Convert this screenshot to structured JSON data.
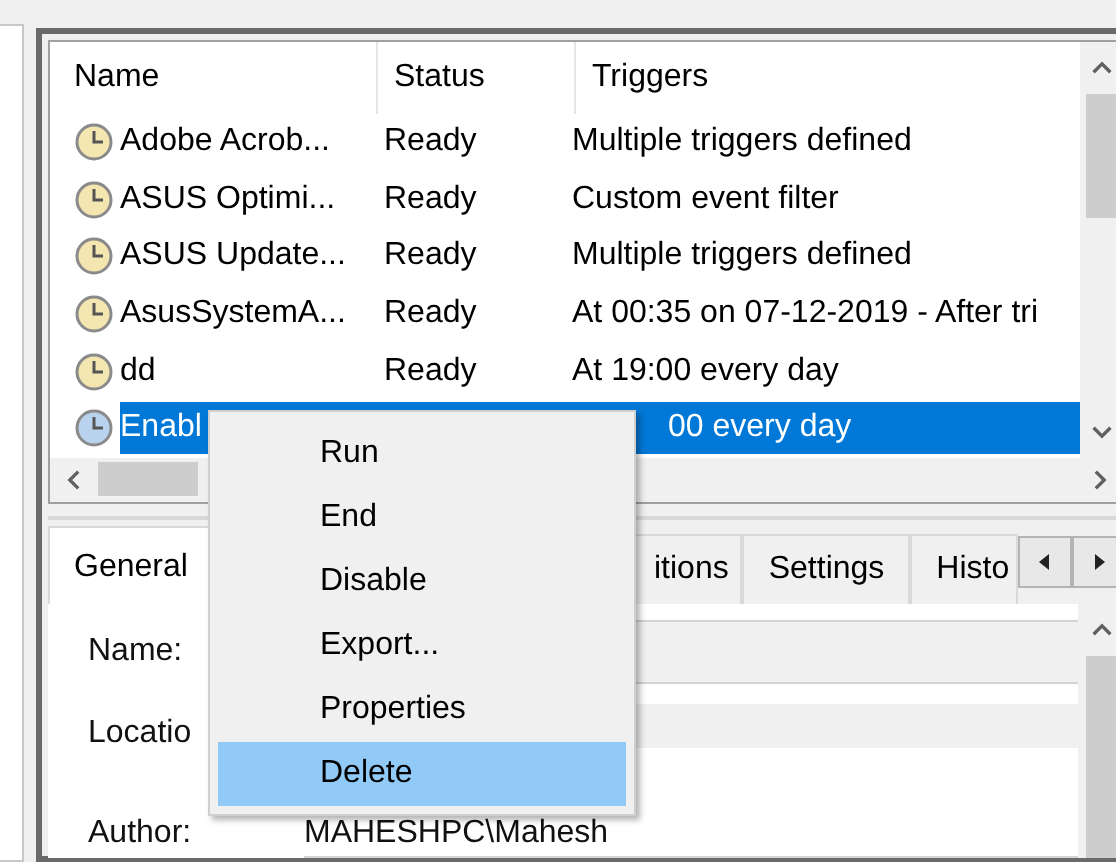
{
  "task_list": {
    "columns": [
      "Name",
      "Status",
      "Triggers"
    ],
    "rows": [
      {
        "name": "Adobe Acrob...",
        "status": "Ready",
        "triggers": "Multiple triggers defined",
        "selected": false
      },
      {
        "name": "ASUS Optimi...",
        "status": "Ready",
        "triggers": "Custom event filter",
        "selected": false
      },
      {
        "name": "ASUS Update...",
        "status": "Ready",
        "triggers": "Multiple triggers defined",
        "selected": false
      },
      {
        "name": "AsusSystemA...",
        "status": "Ready",
        "triggers": "At 00:35 on 07-12-2019 - After tri",
        "selected": false
      },
      {
        "name": "dd",
        "status": "Ready",
        "triggers": "At 19:00 every day",
        "selected": false
      },
      {
        "name": "Enabl",
        "triggers": "00 every day",
        "selected": true
      }
    ]
  },
  "details": {
    "tabs": [
      {
        "label": "General",
        "selected": true
      },
      {
        "label": "itions",
        "selected": false
      },
      {
        "label": "Settings",
        "selected": false
      },
      {
        "label": "Histo",
        "selected": false
      }
    ],
    "fields": [
      {
        "label": "Name:",
        "kind": "box"
      },
      {
        "label": "Locatio",
        "kind": "band"
      },
      {
        "label": "Author:",
        "kind": "text",
        "value": "MAHESHPC\\Mahesh"
      }
    ]
  },
  "context_menu": [
    {
      "label": "Run",
      "selected": false
    },
    {
      "label": "End",
      "selected": false
    },
    {
      "label": "Disable",
      "selected": false
    },
    {
      "label": "Export...",
      "selected": false
    },
    {
      "label": "Properties",
      "selected": false
    },
    {
      "label": "Delete",
      "selected": true
    }
  ]
}
